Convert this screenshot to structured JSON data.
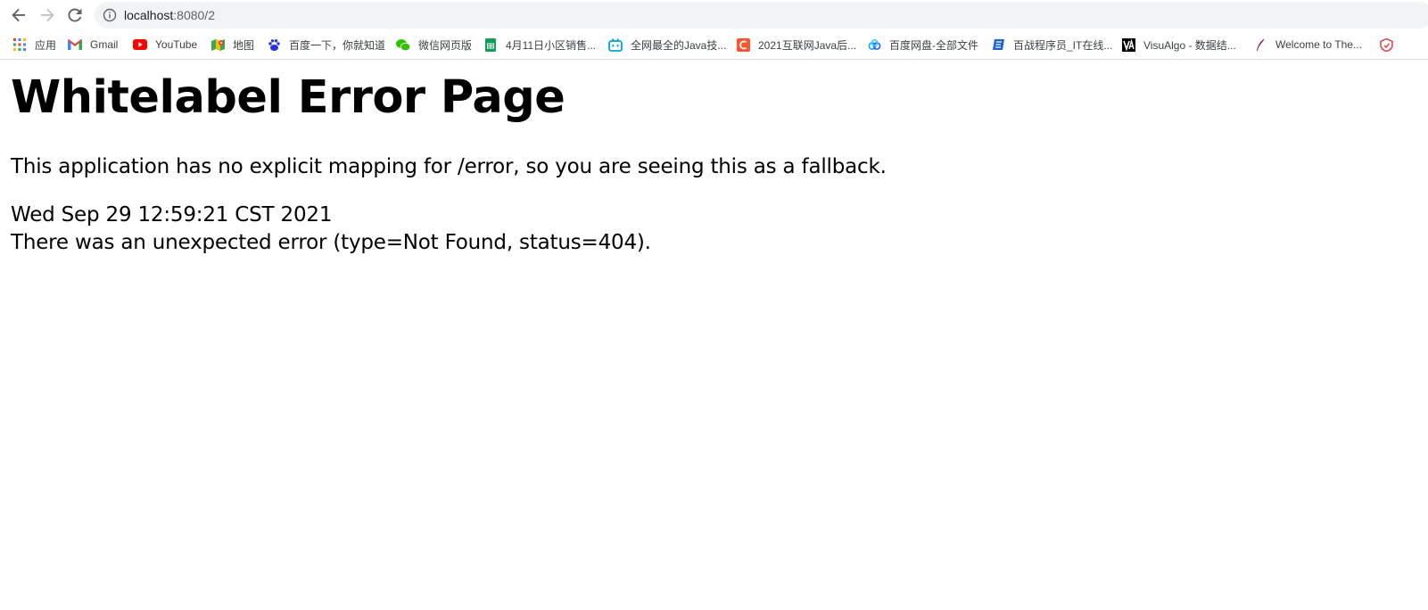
{
  "browser": {
    "url_host": "localhost",
    "url_path": ":8080/2",
    "nav_icons": [
      "back-arrow-icon",
      "forward-arrow-icon",
      "reload-icon",
      "info-icon"
    ]
  },
  "bookmarks": [
    {
      "label": "应用",
      "icon": "apps-grid-icon"
    },
    {
      "label": "Gmail",
      "icon": "gmail-icon"
    },
    {
      "label": "YouTube",
      "icon": "youtube-icon"
    },
    {
      "label": "地图",
      "icon": "maps-icon"
    },
    {
      "label": "百度一下，你就知道",
      "icon": "baidu-icon"
    },
    {
      "label": "微信网页版",
      "icon": "wechat-icon"
    },
    {
      "label": "4月11日小区销售...",
      "icon": "sheets-icon"
    },
    {
      "label": "全网最全的Java技...",
      "icon": "bilibili-icon"
    },
    {
      "label": "2021互联网Java后...",
      "icon": "c-orange-icon"
    },
    {
      "label": "百度网盘-全部文件",
      "icon": "baidu-pan-icon"
    },
    {
      "label": "百战程序员_IT在线...",
      "icon": "bz-icon"
    },
    {
      "label": "VisuAlgo - 数据结...",
      "icon": "visualgo-icon"
    },
    {
      "label": "Welcome to The...",
      "icon": "feather-icon"
    },
    {
      "label": "",
      "icon": "red-shield-icon"
    }
  ],
  "page": {
    "title": "Whitelabel Error Page",
    "message": "This application has no explicit mapping for /error, so you are seeing this as a fallback.",
    "timestamp": "Wed Sep 29 12:59:21 CST 2021",
    "error": "There was an unexpected error (type=Not Found, status=404)."
  },
  "colors": {
    "omnibox_bg": "#f1f3f4",
    "youtube_red": "#ff0000",
    "gmail_red": "#ea4335",
    "wechat_green": "#2dc100",
    "sheets_green": "#0f9d58",
    "bilibili_blue": "#00a1d6",
    "baidu_blue": "#2932e1"
  }
}
